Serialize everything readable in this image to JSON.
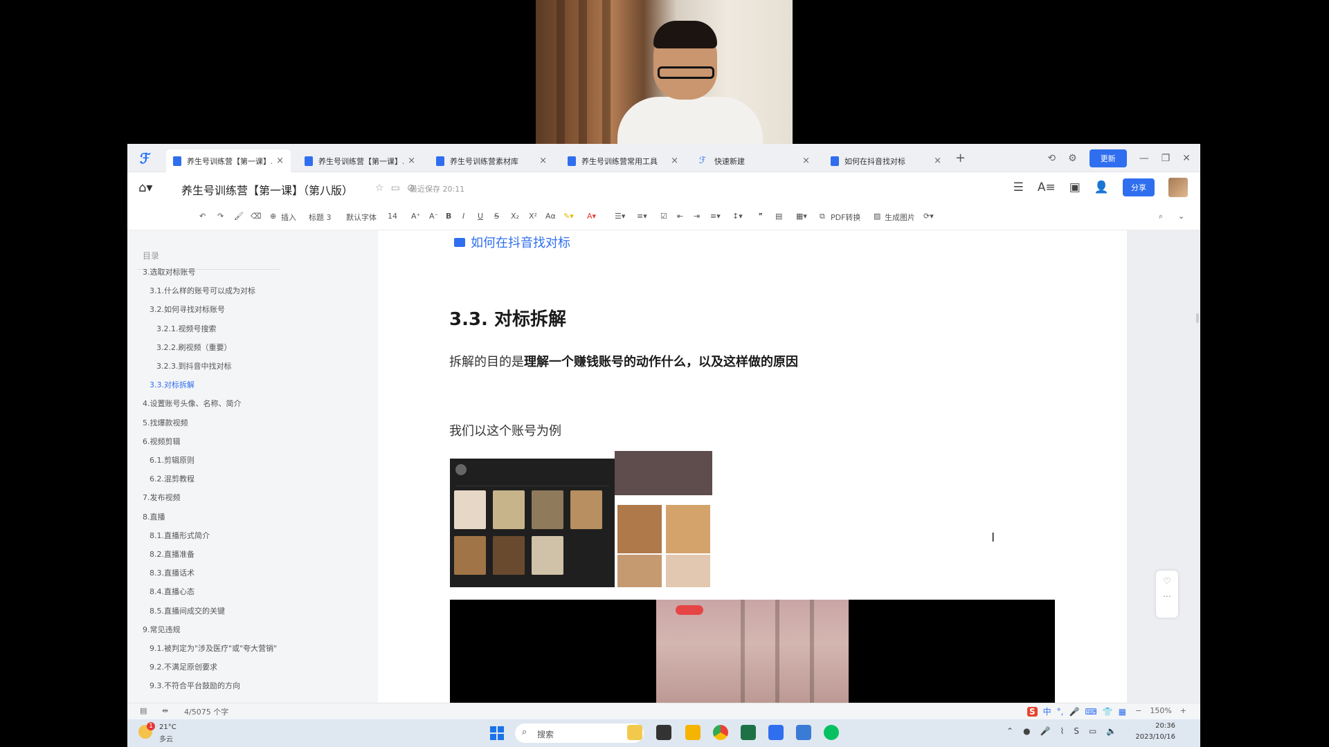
{
  "tabs": [
    {
      "label": "养生号训练营【第一课】...",
      "active": true,
      "icon": "doc-icon"
    },
    {
      "label": "养生号训练营【第一课】...",
      "active": false,
      "icon": "doc-icon"
    },
    {
      "label": "养生号训练营素材库",
      "active": false,
      "icon": "doc-icon"
    },
    {
      "label": "养生号训练营常用工具",
      "active": false,
      "icon": "doc-icon"
    },
    {
      "label": "快速新建",
      "active": false,
      "icon": "app-icon"
    },
    {
      "label": "如何在抖音找对标",
      "active": false,
      "icon": "doc-icon"
    }
  ],
  "window": {
    "update_label": "更新"
  },
  "title_bar": {
    "doc_title": "养生号训练营【第一课】（第八版）",
    "save_status": "最近保存 20:11",
    "share_label": "分享"
  },
  "toolbar": {
    "insert": "插入",
    "heading": "标题 3",
    "font": "默认字体",
    "size": "14",
    "pdf": "PDF转换",
    "gen_image": "生成图片"
  },
  "toc": {
    "title": "目录",
    "items": [
      {
        "label": "3.选取对标账号",
        "level": 1
      },
      {
        "label": "3.1.什么样的账号可以成为对标",
        "level": 2
      },
      {
        "label": "3.2.如何寻找对标账号",
        "level": 2
      },
      {
        "label": "3.2.1.视频号搜索",
        "level": 3
      },
      {
        "label": "3.2.2.刷视频（重要）",
        "level": 3
      },
      {
        "label": "3.2.3.到抖音中找对标",
        "level": 3
      },
      {
        "label": "3.3.对标拆解",
        "level": 2,
        "active": true
      },
      {
        "label": "4.设置账号头像、名称、简介",
        "level": 1
      },
      {
        "label": "5.找爆款视频",
        "level": 1
      },
      {
        "label": "6.视频剪辑",
        "level": 1
      },
      {
        "label": "6.1.剪辑原则",
        "level": 2
      },
      {
        "label": "6.2.混剪教程",
        "level": 2
      },
      {
        "label": "7.发布视频",
        "level": 1
      },
      {
        "label": "8.直播",
        "level": 1
      },
      {
        "label": "8.1.直播形式简介",
        "level": 2
      },
      {
        "label": "8.2.直播准备",
        "level": 2
      },
      {
        "label": "8.3.直播话术",
        "level": 2
      },
      {
        "label": "8.4.直播心态",
        "level": 2
      },
      {
        "label": "8.5.直播间成交的关键",
        "level": 2
      },
      {
        "label": "9.常见违规",
        "level": 1
      },
      {
        "label": "9.1.被判定为\"涉及医疗\"或\"夸大营销\"",
        "level": 2
      },
      {
        "label": "9.2.不满足原创要求",
        "level": 2
      },
      {
        "label": "9.3.不符合平台鼓励的方向",
        "level": 2
      }
    ]
  },
  "document": {
    "link_text": "如何在抖音找对标",
    "heading": "3.3. 对标拆解",
    "para1_prefix": "拆解的目的是",
    "para1_bold": "理解一个赚钱账号的动作什么，以及这样做的原因",
    "para2": "我们以这个账号为例"
  },
  "statusbar": {
    "word_count": "4/5075 个字",
    "ime_label": "中",
    "zoom": "150%"
  },
  "taskbar": {
    "weather_badge": "1",
    "temperature": "21°C",
    "weather_desc": "多云",
    "search_placeholder": "搜索",
    "time": "20:36",
    "date": "2023/10/16"
  },
  "colors": {
    "accent": "#2f6fef",
    "page_bg": "#ffffff",
    "sidebar_bg": "#f4f5f7"
  }
}
